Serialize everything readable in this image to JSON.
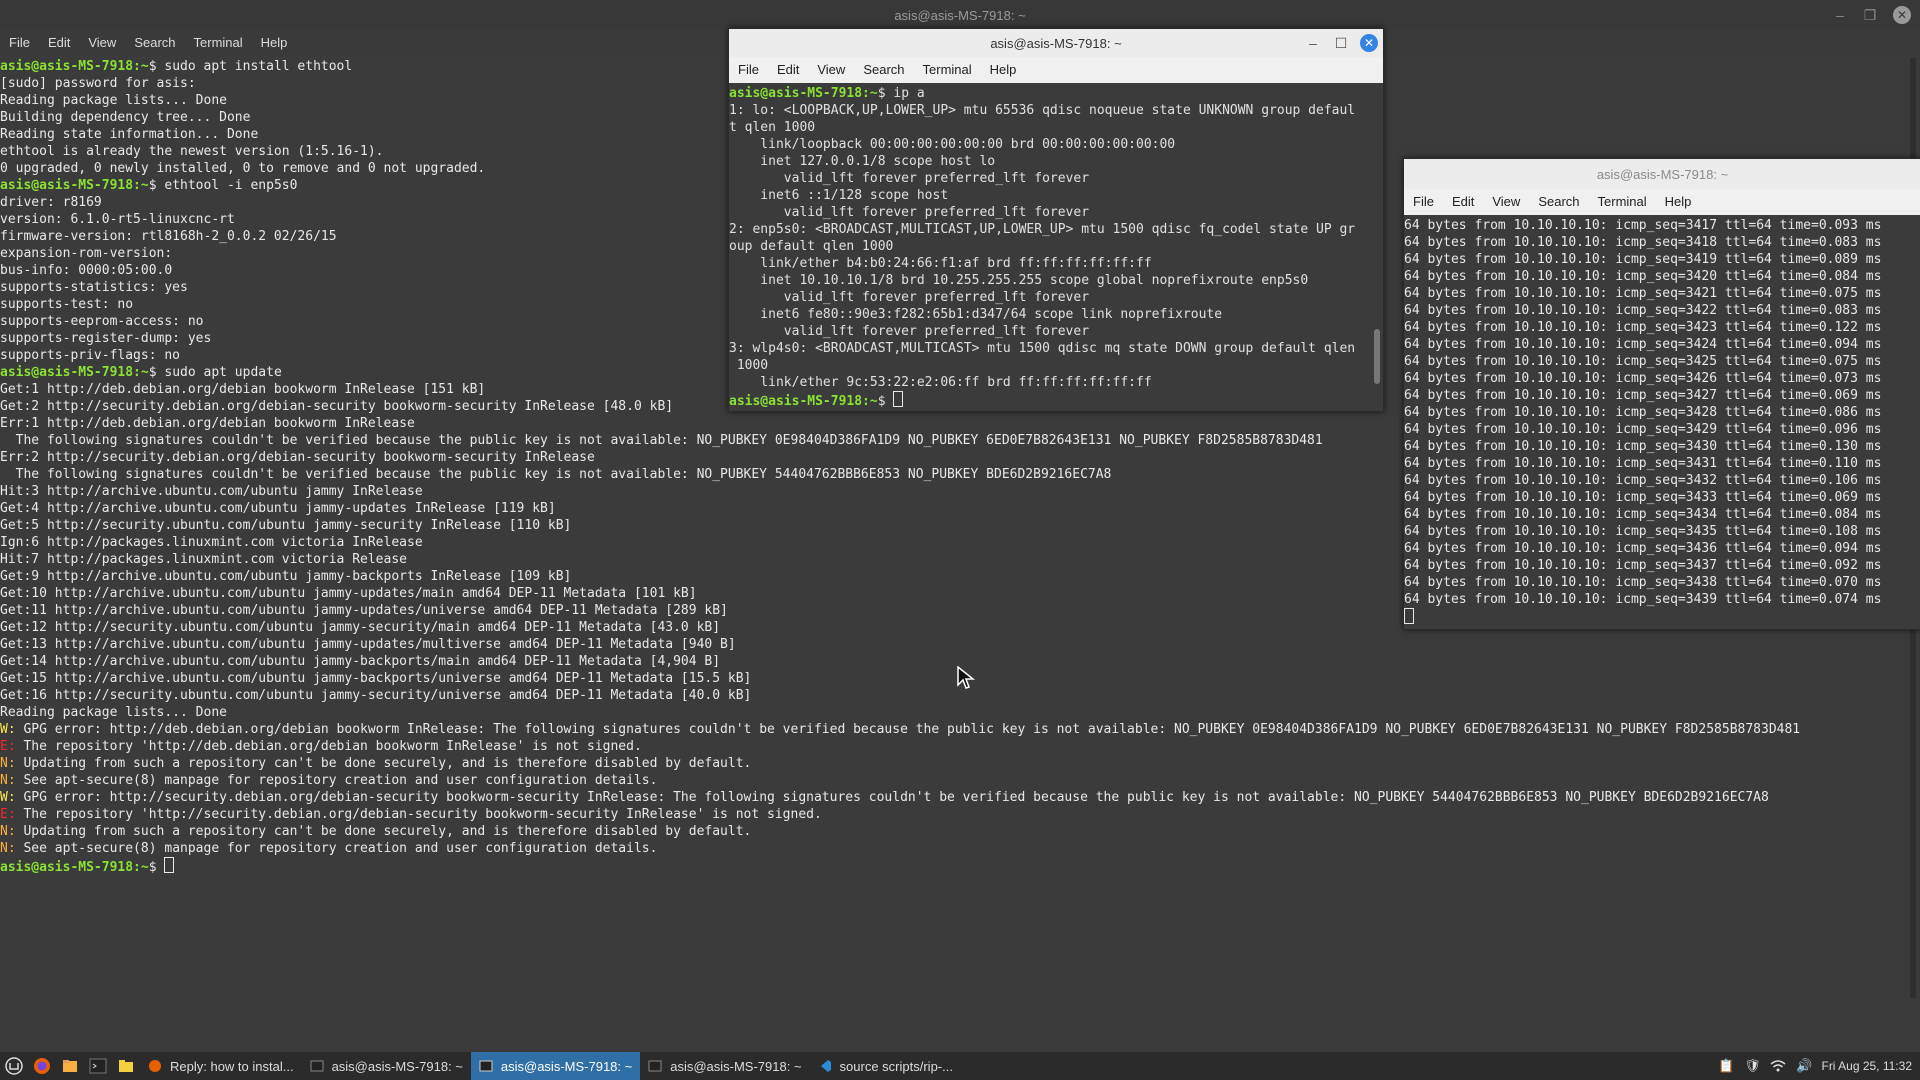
{
  "main_window": {
    "title": "asis@asis-MS-7918: ~",
    "menu": [
      "File",
      "Edit",
      "View",
      "Search",
      "Terminal",
      "Help"
    ],
    "prompt": "asis@asis-MS-7918:~",
    "lines": [
      {
        "p": "asis@asis-MS-7918:~",
        "t": "$ sudo apt install ethtool"
      },
      {
        "t": "[sudo] password for asis:"
      },
      {
        "t": "Reading package lists... Done"
      },
      {
        "t": "Building dependency tree... Done"
      },
      {
        "t": "Reading state information... Done"
      },
      {
        "t": "ethtool is already the newest version (1:5.16-1)."
      },
      {
        "t": "0 upgraded, 0 newly installed, 0 to remove and 0 not upgraded."
      },
      {
        "p": "asis@asis-MS-7918:~",
        "t": "$ ethtool -i enp5s0"
      },
      {
        "t": "driver: r8169"
      },
      {
        "t": "version: 6.1.0-rt5-linuxcnc-rt"
      },
      {
        "t": "firmware-version: rtl8168h-2_0.0.2 02/26/15"
      },
      {
        "t": "expansion-rom-version:"
      },
      {
        "t": "bus-info: 0000:05:00.0"
      },
      {
        "t": "supports-statistics: yes"
      },
      {
        "t": "supports-test: no"
      },
      {
        "t": "supports-eeprom-access: no"
      },
      {
        "t": "supports-register-dump: yes"
      },
      {
        "t": "supports-priv-flags: no"
      },
      {
        "p": "asis@asis-MS-7918:~",
        "t": "$ sudo apt update"
      },
      {
        "t": "Get:1 http://deb.debian.org/debian bookworm InRelease [151 kB]"
      },
      {
        "t": "Get:2 http://security.debian.org/debian-security bookworm-security InRelease [48.0 kB]"
      },
      {
        "t": "Err:1 http://deb.debian.org/debian bookworm InRelease"
      },
      {
        "t": "  The following signatures couldn't be verified because the public key is not available: NO_PUBKEY 0E98404D386FA1D9 NO_PUBKEY 6ED0E7B82643E131 NO_PUBKEY F8D2585B8783D481"
      },
      {
        "t": "Err:2 http://security.debian.org/debian-security bookworm-security InRelease"
      },
      {
        "t": "  The following signatures couldn't be verified because the public key is not available: NO_PUBKEY 54404762BBB6E853 NO_PUBKEY BDE6D2B9216EC7A8"
      },
      {
        "t": "Hit:3 http://archive.ubuntu.com/ubuntu jammy InRelease"
      },
      {
        "t": "Get:4 http://archive.ubuntu.com/ubuntu jammy-updates InRelease [119 kB]"
      },
      {
        "t": "Get:5 http://security.ubuntu.com/ubuntu jammy-security InRelease [110 kB]"
      },
      {
        "t": "Ign:6 http://packages.linuxmint.com victoria InRelease"
      },
      {
        "t": "Hit:7 http://packages.linuxmint.com victoria Release"
      },
      {
        "t": "Get:9 http://archive.ubuntu.com/ubuntu jammy-backports InRelease [109 kB]"
      },
      {
        "t": "Get:10 http://archive.ubuntu.com/ubuntu jammy-updates/main amd64 DEP-11 Metadata [101 kB]"
      },
      {
        "t": "Get:11 http://archive.ubuntu.com/ubuntu jammy-updates/universe amd64 DEP-11 Metadata [289 kB]"
      },
      {
        "t": "Get:12 http://security.ubuntu.com/ubuntu jammy-security/main amd64 DEP-11 Metadata [43.0 kB]"
      },
      {
        "t": "Get:13 http://archive.ubuntu.com/ubuntu jammy-updates/multiverse amd64 DEP-11 Metadata [940 B]"
      },
      {
        "t": "Get:14 http://archive.ubuntu.com/ubuntu jammy-backports/main amd64 DEP-11 Metadata [4,904 B]"
      },
      {
        "t": "Get:15 http://archive.ubuntu.com/ubuntu jammy-backports/universe amd64 DEP-11 Metadata [15.5 kB]"
      },
      {
        "t": "Get:16 http://security.ubuntu.com/ubuntu jammy-security/universe amd64 DEP-11 Metadata [40.0 kB]"
      },
      {
        "t": "Reading package lists... Done"
      },
      {
        "tag": "W:",
        "tagc": "w",
        "t": " GPG error: http://deb.debian.org/debian bookworm InRelease: The following signatures couldn't be verified because the public key is not available: NO_PUBKEY 0E98404D386FA1D9 NO_PUBKEY 6ED0E7B82643E131 NO_PUBKEY F8D2585B8783D481"
      },
      {
        "tag": "E:",
        "tagc": "e",
        "t": " The repository 'http://deb.debian.org/debian bookworm InRelease' is not signed."
      },
      {
        "tag": "N:",
        "tagc": "n",
        "t": " Updating from such a repository can't be done securely, and is therefore disabled by default."
      },
      {
        "tag": "N:",
        "tagc": "n",
        "t": " See apt-secure(8) manpage for repository creation and user configuration details."
      },
      {
        "tag": "W:",
        "tagc": "w",
        "t": " GPG error: http://security.debian.org/debian-security bookworm-security InRelease: The following signatures couldn't be verified because the public key is not available: NO_PUBKEY 54404762BBB6E853 NO_PUBKEY BDE6D2B9216EC7A8"
      },
      {
        "tag": "E:",
        "tagc": "e",
        "t": " The repository 'http://security.debian.org/debian-security bookworm-security InRelease' is not signed."
      },
      {
        "tag": "N:",
        "tagc": "n",
        "t": " Updating from such a repository can't be done securely, and is therefore disabled by default."
      },
      {
        "tag": "N:",
        "tagc": "n",
        "t": " See apt-secure(8) manpage for repository creation and user configuration details."
      },
      {
        "p": "asis@asis-MS-7918:~",
        "t": "$ ",
        "cursor": true
      }
    ]
  },
  "window2": {
    "title": "asis@asis-MS-7918: ~",
    "menu": [
      "File",
      "Edit",
      "View",
      "Search",
      "Terminal",
      "Help"
    ],
    "lines": [
      {
        "p": "asis@asis-MS-7918:~",
        "t": "$ ip a"
      },
      {
        "t": "1: lo: <LOOPBACK,UP,LOWER_UP> mtu 65536 qdisc noqueue state UNKNOWN group defaul"
      },
      {
        "t": "t qlen 1000"
      },
      {
        "t": "    link/loopback 00:00:00:00:00:00 brd 00:00:00:00:00:00"
      },
      {
        "t": "    inet 127.0.0.1/8 scope host lo"
      },
      {
        "t": "       valid_lft forever preferred_lft forever"
      },
      {
        "t": "    inet6 ::1/128 scope host"
      },
      {
        "t": "       valid_lft forever preferred_lft forever"
      },
      {
        "t": "2: enp5s0: <BROADCAST,MULTICAST,UP,LOWER_UP> mtu 1500 qdisc fq_codel state UP gr"
      },
      {
        "t": "oup default qlen 1000"
      },
      {
        "t": "    link/ether b4:b0:24:66:f1:af brd ff:ff:ff:ff:ff:ff"
      },
      {
        "t": "    inet 10.10.10.1/8 brd 10.255.255.255 scope global noprefixroute enp5s0"
      },
      {
        "t": "       valid_lft forever preferred_lft forever"
      },
      {
        "t": "    inet6 fe80::90e3:f282:65b1:d347/64 scope link noprefixroute"
      },
      {
        "t": "       valid_lft forever preferred_lft forever"
      },
      {
        "t": "3: wlp4s0: <BROADCAST,MULTICAST> mtu 1500 qdisc mq state DOWN group default qlen"
      },
      {
        "t": " 1000"
      },
      {
        "t": "    link/ether 9c:53:22:e2:06:ff brd ff:ff:ff:ff:ff:ff"
      },
      {
        "p": "asis@asis-MS-7918:~",
        "t": "$ ",
        "cursor": true
      }
    ]
  },
  "window3": {
    "title": "asis@asis-MS-7918: ~",
    "menu": [
      "File",
      "Edit",
      "View",
      "Search",
      "Terminal",
      "Help"
    ],
    "lines": [
      {
        "t": "64 bytes from 10.10.10.10: icmp_seq=3417 ttl=64 time=0.093 ms"
      },
      {
        "t": "64 bytes from 10.10.10.10: icmp_seq=3418 ttl=64 time=0.083 ms"
      },
      {
        "t": "64 bytes from 10.10.10.10: icmp_seq=3419 ttl=64 time=0.089 ms"
      },
      {
        "t": "64 bytes from 10.10.10.10: icmp_seq=3420 ttl=64 time=0.084 ms"
      },
      {
        "t": "64 bytes from 10.10.10.10: icmp_seq=3421 ttl=64 time=0.075 ms"
      },
      {
        "t": "64 bytes from 10.10.10.10: icmp_seq=3422 ttl=64 time=0.083 ms"
      },
      {
        "t": "64 bytes from 10.10.10.10: icmp_seq=3423 ttl=64 time=0.122 ms"
      },
      {
        "t": "64 bytes from 10.10.10.10: icmp_seq=3424 ttl=64 time=0.094 ms"
      },
      {
        "t": "64 bytes from 10.10.10.10: icmp_seq=3425 ttl=64 time=0.075 ms"
      },
      {
        "t": "64 bytes from 10.10.10.10: icmp_seq=3426 ttl=64 time=0.073 ms"
      },
      {
        "t": "64 bytes from 10.10.10.10: icmp_seq=3427 ttl=64 time=0.069 ms"
      },
      {
        "t": "64 bytes from 10.10.10.10: icmp_seq=3428 ttl=64 time=0.086 ms"
      },
      {
        "t": "64 bytes from 10.10.10.10: icmp_seq=3429 ttl=64 time=0.096 ms"
      },
      {
        "t": "64 bytes from 10.10.10.10: icmp_seq=3430 ttl=64 time=0.130 ms"
      },
      {
        "t": "64 bytes from 10.10.10.10: icmp_seq=3431 ttl=64 time=0.110 ms"
      },
      {
        "t": "64 bytes from 10.10.10.10: icmp_seq=3432 ttl=64 time=0.106 ms"
      },
      {
        "t": "64 bytes from 10.10.10.10: icmp_seq=3433 ttl=64 time=0.069 ms"
      },
      {
        "t": "64 bytes from 10.10.10.10: icmp_seq=3434 ttl=64 time=0.084 ms"
      },
      {
        "t": "64 bytes from 10.10.10.10: icmp_seq=3435 ttl=64 time=0.108 ms"
      },
      {
        "t": "64 bytes from 10.10.10.10: icmp_seq=3436 ttl=64 time=0.094 ms"
      },
      {
        "t": "64 bytes from 10.10.10.10: icmp_seq=3437 ttl=64 time=0.092 ms"
      },
      {
        "t": "64 bytes from 10.10.10.10: icmp_seq=3438 ttl=64 time=0.070 ms"
      },
      {
        "t": "64 bytes from 10.10.10.10: icmp_seq=3439 ttl=64 time=0.074 ms"
      },
      {
        "t": "",
        "cursor": true
      }
    ]
  },
  "taskbar": {
    "tasks": [
      {
        "label": "Reply: how to instal...",
        "icon": "firefox-icon"
      },
      {
        "label": "asis@asis-MS-7918: ~",
        "icon": "terminal-icon"
      },
      {
        "label": "asis@asis-MS-7918: ~",
        "icon": "terminal-icon",
        "active": true
      },
      {
        "label": "asis@asis-MS-7918: ~",
        "icon": "terminal-icon"
      },
      {
        "label": "source scripts/rip-...",
        "icon": "vscode-icon"
      }
    ],
    "clock": "Fri Aug 25, 11:32"
  },
  "colors": {
    "prompt": "#8ae234",
    "warn": "#fce94f",
    "error": "#ef2929",
    "note": "#fcaf3e",
    "active_task": "#2f6fa6"
  }
}
